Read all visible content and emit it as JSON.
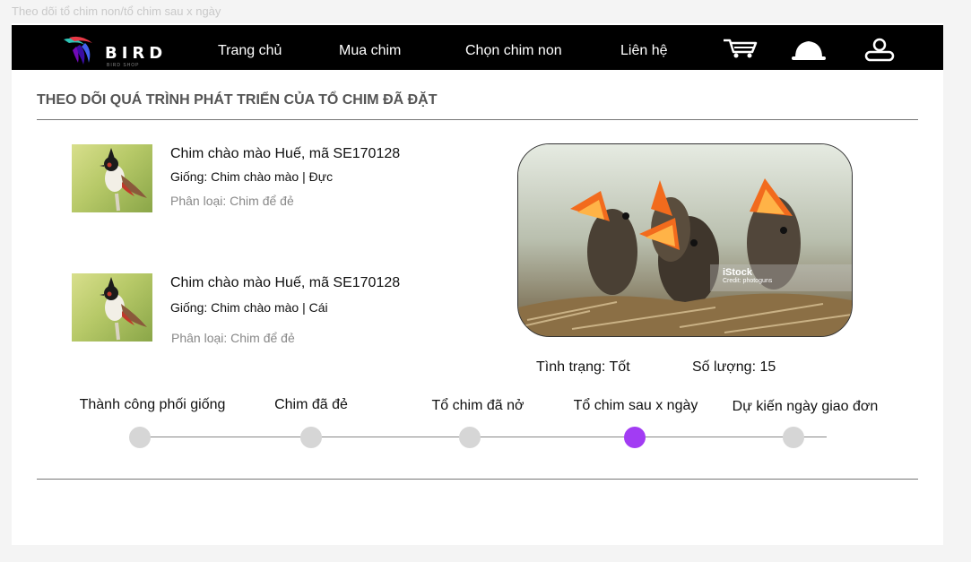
{
  "frame_label": "Theo dõi tổ chim non/tổ chim sau x ngày",
  "nav": {
    "logo_text": "BIRD",
    "logo_sub": "BIRD SHOP",
    "links": [
      "Trang chủ",
      "Mua chim",
      "Chọn chim non",
      "Liên hệ"
    ],
    "icons": [
      "cart-icon",
      "bell-icon",
      "user-icon"
    ]
  },
  "page_title": "THEO DÕI QUÁ TRÌNH PHÁT TRIỂN CỦA TỔ CHIM ĐÃ ĐẶT",
  "birds": [
    {
      "name": "Chim chào mào Huế, mã SE170128",
      "breed": "Giống: Chim chào mào | Đực",
      "type": "Phân loại: Chim để đẻ"
    },
    {
      "name": "Chim chào mào Huế, mã SE170128",
      "breed": "Giống: Chim chào mào | Cái",
      "type": "Phân loại: Chim để đẻ"
    }
  ],
  "photo": {
    "watermark": "iStock",
    "credit": "Credit: photoguns"
  },
  "status": "Tình trạng: Tốt",
  "quantity": "Số lượng: 15",
  "timeline": {
    "steps": [
      "Thành công phối giống",
      "Chim đã đẻ",
      "Tổ chim đã nở",
      "Tổ chim sau x ngày",
      "Dự kiến ngày giao đơn"
    ],
    "active_index": 3
  },
  "colors": {
    "accent": "#a23cf3",
    "inactive": "#d6d6d6",
    "nav_bg": "#000000"
  }
}
